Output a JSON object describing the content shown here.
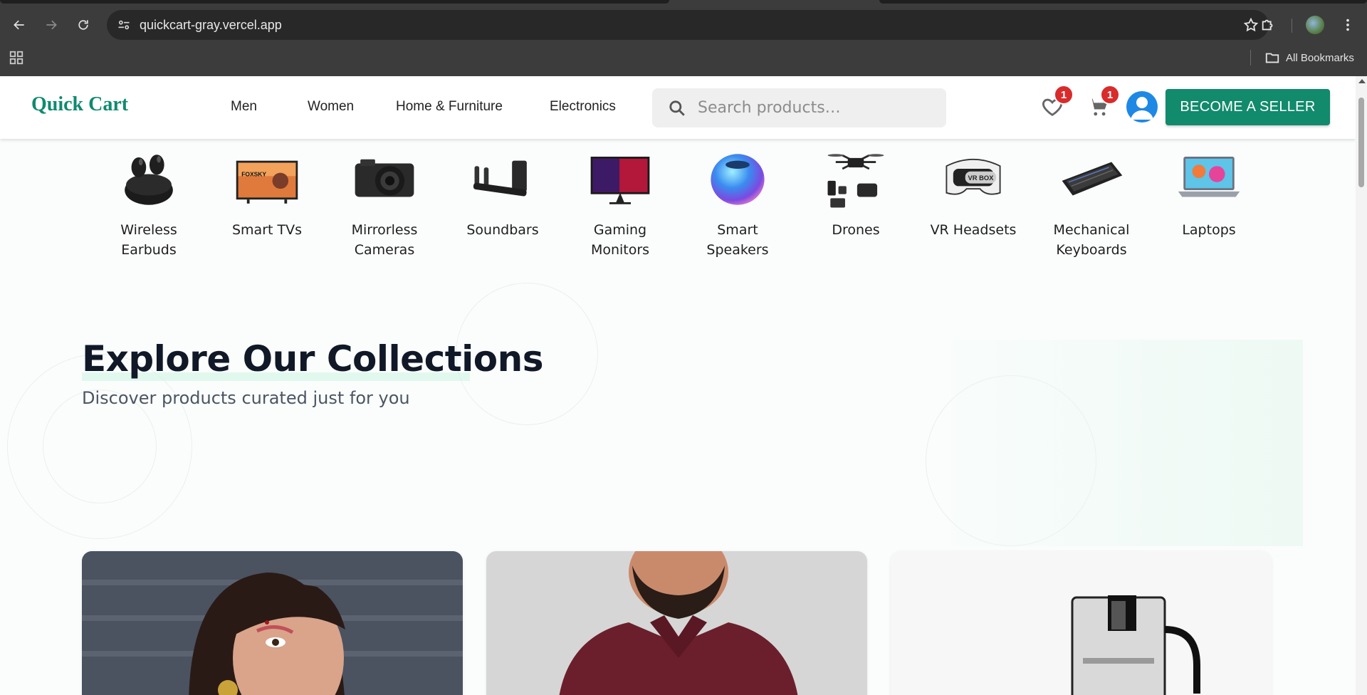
{
  "browser": {
    "url": "quickcart-gray.vercel.app",
    "bookmarks_label": "All Bookmarks"
  },
  "header": {
    "logo": "Quick Cart",
    "nav": [
      "Men",
      "Women",
      "Home & Furniture",
      "Electronics"
    ],
    "search_placeholder": "Search products…",
    "wishlist_count": "1",
    "cart_count": "1",
    "seller_button": "BECOME A SELLER"
  },
  "categories": [
    {
      "label": "Wireless Earbuds",
      "icon": "earbuds-icon"
    },
    {
      "label": "Smart TVs",
      "icon": "tv-icon"
    },
    {
      "label": "Mirrorless Cameras",
      "icon": "camera-icon"
    },
    {
      "label": "Soundbars",
      "icon": "soundbar-icon"
    },
    {
      "label": "Gaming Monitors",
      "icon": "monitor-icon"
    },
    {
      "label": "Smart Speakers",
      "icon": "speaker-icon"
    },
    {
      "label": "Drones",
      "icon": "drone-icon"
    },
    {
      "label": "VR Headsets",
      "icon": "vr-headset-icon"
    },
    {
      "label": "Mechanical Keyboards",
      "icon": "keyboard-icon"
    },
    {
      "label": "Laptops",
      "icon": "laptop-icon"
    }
  ],
  "hero": {
    "title": "Explore Our Collections",
    "subtitle": "Discover products curated just for you"
  },
  "image_text": {
    "tv_brand": "FOXSKY",
    "vr_box": "VR BOX"
  },
  "colors": {
    "brand": "#0f8a6f",
    "seller_button": "#128a6c",
    "badge": "#d92b2b",
    "avatar": "#1e88e5"
  }
}
